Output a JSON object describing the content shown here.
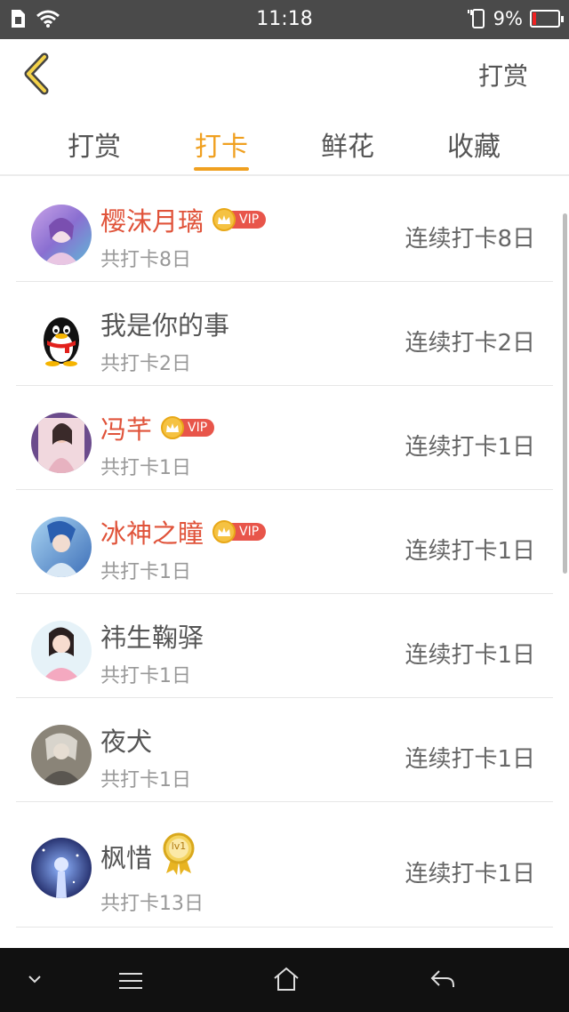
{
  "status_bar": {
    "time": "11:18",
    "battery": "9%",
    "battery_level": 0.09
  },
  "header": {
    "action_label": "打赏"
  },
  "tabs": [
    {
      "label": "打赏",
      "active": false
    },
    {
      "label": "打卡",
      "active": true
    },
    {
      "label": "鲜花",
      "active": false
    },
    {
      "label": "收藏",
      "active": false
    }
  ],
  "badges": {
    "vip": "VIP",
    "level": "lv1"
  },
  "items": [
    {
      "name": "樱沫月璃",
      "vip": true,
      "total": "共打卡8日",
      "streak": "连续打卡8日"
    },
    {
      "name": "我是你的事",
      "vip": false,
      "total": "共打卡2日",
      "streak": "连续打卡2日"
    },
    {
      "name": "冯芊",
      "vip": true,
      "total": "共打卡1日",
      "streak": "连续打卡1日"
    },
    {
      "name": "冰神之瞳",
      "vip": true,
      "total": "共打卡1日",
      "streak": "连续打卡1日"
    },
    {
      "name": "祎生鞠驿",
      "vip": false,
      "total": "共打卡1日",
      "streak": "连续打卡1日"
    },
    {
      "name": "夜犬",
      "vip": false,
      "total": "共打卡1日",
      "streak": "连续打卡1日"
    },
    {
      "name": "枫惜",
      "vip": false,
      "level": true,
      "total": "共打卡13日",
      "streak": "连续打卡1日"
    }
  ],
  "colors": {
    "accent": "#f0a020",
    "vip_name": "#e0533a",
    "vip_tag": "#e8554a",
    "status_bar": "#4a4a4a",
    "nav_bar": "#111111"
  }
}
